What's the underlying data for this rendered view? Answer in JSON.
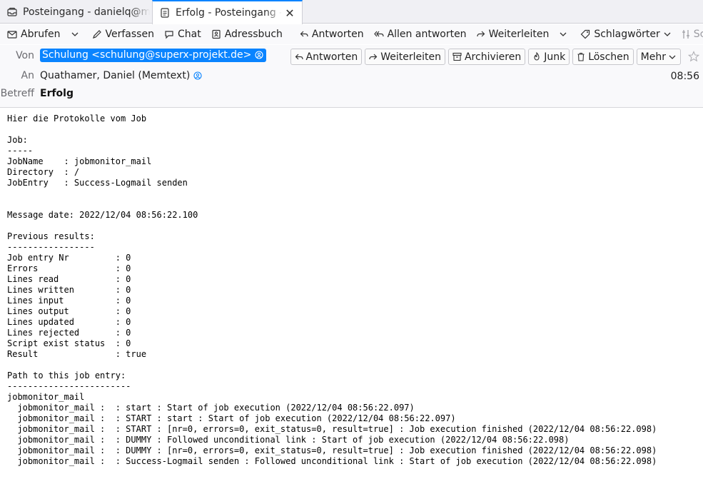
{
  "tabs": [
    {
      "title": "Posteingang - danielq@m",
      "icon": "inbox-icon"
    },
    {
      "title": "Erfolg - Posteingang - ",
      "icon": "message-icon",
      "close": "✕"
    }
  ],
  "toolbar": {
    "abrufen": "Abrufen",
    "verfassen": "Verfassen",
    "chat": "Chat",
    "adressbuch": "Adressbuch",
    "antworten": "Antworten",
    "allen_antworten": "Allen antworten",
    "weiterleiten": "Weiterleiten",
    "schlagwoerter": "Schlagwörter",
    "schnellfilter": "Schnellf"
  },
  "header": {
    "from_label": "Von",
    "from_value": "Schulung <schulung@superx-projekt.de>",
    "to_label": "An",
    "to_value": "Quathamer, Daniel (Memtext)",
    "subject_label": "Betreff",
    "subject_value": "Erfolg",
    "time": "08:56",
    "buttons": {
      "reply": "Antworten",
      "forward": "Weiterleiten",
      "archive": "Archivieren",
      "junk": "Junk",
      "delete": "Löschen",
      "more": "Mehr"
    }
  },
  "body_lines": [
    "Hier die Protokolle vom Job",
    "",
    "Job:",
    "-----",
    "JobName    : jobmonitor_mail",
    "Directory  : /",
    "JobEntry   : Success-Logmail senden",
    "",
    "",
    "Message date: 2022/12/04 08:56:22.100",
    "",
    "Previous results:",
    "-----------------",
    "Job entry Nr         : 0",
    "Errors               : 0",
    "Lines read           : 0",
    "Lines written        : 0",
    "Lines input          : 0",
    "Lines output         : 0",
    "Lines updated        : 0",
    "Lines rejected       : 0",
    "Script exist status  : 0",
    "Result               : true",
    "",
    "Path to this job entry:",
    "------------------------",
    "jobmonitor_mail",
    "  jobmonitor_mail :  : start : Start of job execution (2022/12/04 08:56:22.097)",
    "  jobmonitor_mail :  : START : start : Start of job execution (2022/12/04 08:56:22.097)",
    "  jobmonitor_mail :  : START : [nr=0, errors=0, exit_status=0, result=true] : Job execution finished (2022/12/04 08:56:22.098)",
    "  jobmonitor_mail :  : DUMMY : Followed unconditional link : Start of job execution (2022/12/04 08:56:22.098)",
    "  jobmonitor_mail :  : DUMMY : [nr=0, errors=0, exit_status=0, result=true] : Job execution finished (2022/12/04 08:56:22.098)",
    "  jobmonitor_mail :  : Success-Logmail senden : Followed unconditional link : Start of job execution (2022/12/04 08:56:22.098)"
  ]
}
